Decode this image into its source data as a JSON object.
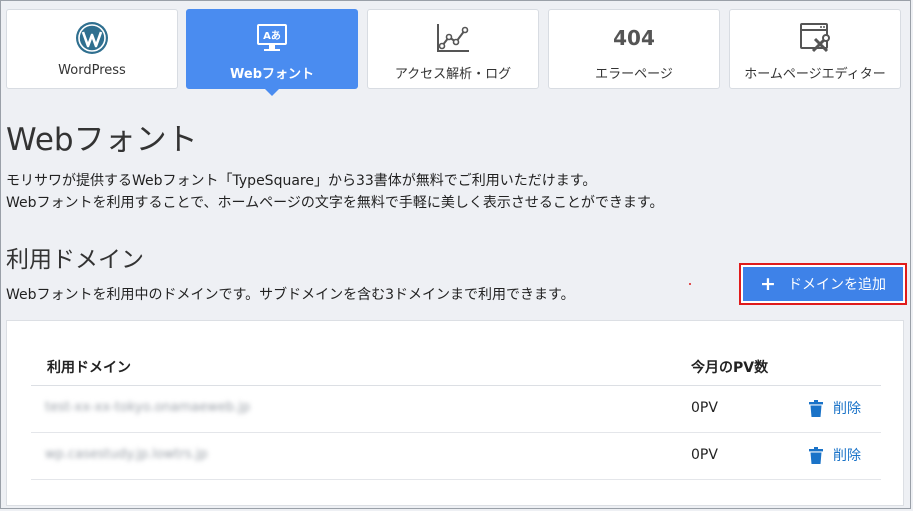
{
  "tabs": [
    {
      "label": "WordPress",
      "icon": "wordpress-icon",
      "active": false
    },
    {
      "label": "Webフォント",
      "icon": "webfont-icon",
      "active": true
    },
    {
      "label": "アクセス解析・ログ",
      "icon": "line-chart-icon",
      "active": false
    },
    {
      "label": "エラーページ",
      "icon": "error-404-icon",
      "icon_text": "404",
      "active": false
    },
    {
      "label": "ホームページエディター",
      "icon": "editor-tools-icon",
      "active": false
    }
  ],
  "page": {
    "title": "Webフォント",
    "description_line1": "モリサワが提供するWebフォント「TypeSquare」から33書体が無料でご利用いただけます。",
    "description_line2": "Webフォントを利用することで、ホームページの文字を無料で手軽に美しく表示させることができます。"
  },
  "domains": {
    "heading": "利用ドメイン",
    "description": "Webフォントを利用中のドメインです。サブドメインを含む3ドメインまで利用できます。",
    "add_button_label": "ドメインを追加",
    "columns": {
      "domain": "利用ドメイン",
      "pv": "今月のPV数"
    },
    "rows": [
      {
        "domain": "test-xx-xx-tokyo.onamaeweb.jp",
        "pv": "0PV",
        "delete_label": "削除"
      },
      {
        "domain": "wp.casestudy.jp.lowtrs.jp",
        "pv": "0PV",
        "delete_label": "削除"
      }
    ]
  },
  "colors": {
    "accent": "#4a8cf0",
    "button": "#3e82e8",
    "highlight_border": "#e01b1b",
    "link": "#1a73c8"
  }
}
